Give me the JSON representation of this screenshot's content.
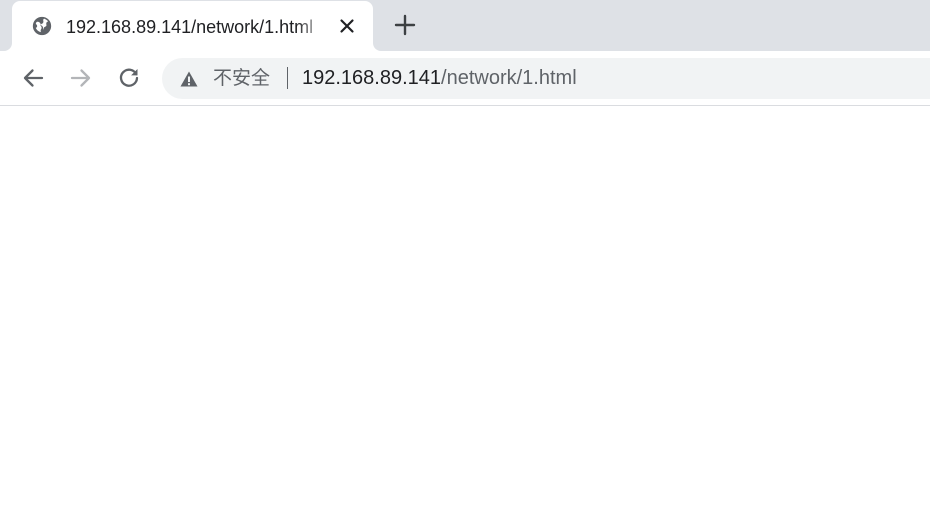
{
  "tab": {
    "title": "192.168.89.141/network/1.html",
    "favicon": "globe-icon",
    "close_icon": "close-icon"
  },
  "new_tab_icon": "plus-icon",
  "toolbar": {
    "back_icon": "back-arrow-icon",
    "forward_icon": "forward-arrow-icon",
    "reload_icon": "reload-icon"
  },
  "omnibox": {
    "security_icon": "warning-icon",
    "security_label": "不安全",
    "url_host": "192.168.89.141",
    "url_path": "/network/1.html"
  },
  "colors": {
    "tabstrip_bg": "#dee1e6",
    "omnibox_bg": "#f1f3f4",
    "icon_active": "#5f6368",
    "icon_disabled": "#b3b5b8",
    "text_primary": "#202124",
    "text_secondary": "#5f6368"
  }
}
